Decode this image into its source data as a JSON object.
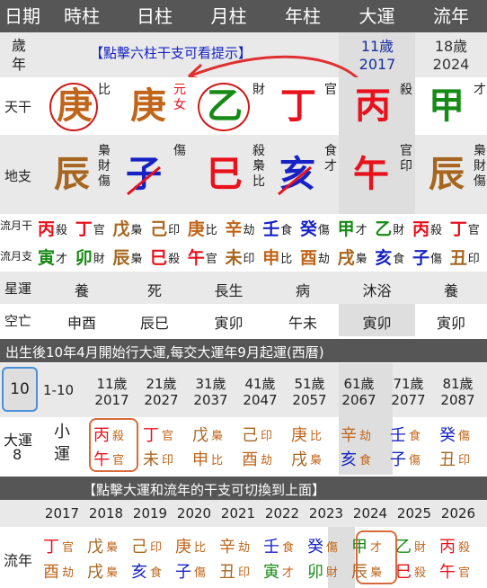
{
  "header": [
    "日期",
    "時柱",
    "日柱",
    "月柱",
    "年柱",
    "大運",
    "流年"
  ],
  "age_label": "歲年",
  "hint_top": "【點擊六柱干支可看提示】",
  "dayun_age": "11歲",
  "dayun_year": "2017",
  "liunian_age": "18歲",
  "liunian_year": "2024",
  "tiangan_label": "天干",
  "tiangan": [
    {
      "c": "庚",
      "g": "比"
    },
    {
      "c": "庚",
      "g": "元女"
    },
    {
      "c": "乙",
      "g": "財"
    },
    {
      "c": "丁",
      "g": "官"
    },
    {
      "c": "丙",
      "g": "殺"
    },
    {
      "c": "甲",
      "g": "才"
    }
  ],
  "dizhi_label": "地支",
  "dizhi": [
    {
      "c": "辰",
      "h": "梟財傷"
    },
    {
      "c": "子",
      "h": "傷"
    },
    {
      "c": "巳",
      "h": "殺梟比"
    },
    {
      "c": "亥",
      "h": "食才"
    },
    {
      "c": "午",
      "h": "官印"
    },
    {
      "c": "辰",
      "h": "梟財傷"
    }
  ],
  "liuyue_gan_label": "流月干",
  "liuyue_gan": [
    [
      "丙",
      "殺"
    ],
    [
      "丁",
      "官"
    ],
    [
      "戊",
      "梟"
    ],
    [
      "己",
      "印"
    ],
    [
      "庚",
      "比"
    ],
    [
      "辛",
      "劫"
    ],
    [
      "壬",
      "食"
    ],
    [
      "癸",
      "傷"
    ],
    [
      "甲",
      "才"
    ],
    [
      "乙",
      "財"
    ],
    [
      "丙",
      "殺"
    ],
    [
      "丁",
      "官"
    ]
  ],
  "liuyue_zhi_label": "流月支",
  "liuyue_zhi": [
    [
      "寅",
      "才"
    ],
    [
      "卯",
      "財"
    ],
    [
      "辰",
      "梟"
    ],
    [
      "巳",
      "殺"
    ],
    [
      "午",
      "官"
    ],
    [
      "未",
      "印"
    ],
    [
      "申",
      "比"
    ],
    [
      "酉",
      "劫"
    ],
    [
      "戌",
      "梟"
    ],
    [
      "亥",
      "食"
    ],
    [
      "子",
      "傷"
    ],
    [
      "丑",
      "印"
    ]
  ],
  "xingyun_label": "星運",
  "xingyun": [
    "養",
    "死",
    "長生",
    "病",
    "沐浴",
    "養"
  ],
  "kongwang_label": "空亡",
  "kongwang": [
    "申酉",
    "辰巳",
    "寅卯",
    "午未",
    "寅卯",
    "寅卯"
  ],
  "qiyun_text": "出生後10年4月開始行大運,每交大運年9月起運(西曆)",
  "dayun_start": "10",
  "dayun_first": "1-10",
  "dayun_ages": [
    "11歲",
    "21歲",
    "31歲",
    "41歲",
    "51歲",
    "61歲",
    "71歲",
    "81歲"
  ],
  "dayun_years": [
    "2017",
    "2027",
    "2037",
    "2047",
    "2057",
    "2067",
    "2077",
    "2087"
  ],
  "dayun_label": "大運",
  "dayun_num": "8",
  "dayun_small": "小運",
  "dayun_pillars": [
    [
      "丙",
      "殺",
      "午",
      "官"
    ],
    [
      "丁",
      "官",
      "未",
      "印"
    ],
    [
      "戊",
      "梟",
      "申",
      "比"
    ],
    [
      "己",
      "印",
      "酉",
      "劫"
    ],
    [
      "庚",
      "比",
      "戌",
      "梟"
    ],
    [
      "辛",
      "劫",
      "亥",
      "食"
    ],
    [
      "壬",
      "食",
      "子",
      "傷"
    ],
    [
      "癸",
      "傷",
      "丑",
      "印"
    ]
  ],
  "hint_bottom": "【點擊大運和流年的干支可切換到上面】",
  "liunian_years": [
    "2017",
    "2018",
    "2019",
    "2020",
    "2021",
    "2022",
    "2023",
    "2024",
    "2025",
    "2026"
  ],
  "liunian_label": "流年",
  "liunian_pillars": [
    [
      "丁",
      "官",
      "酉",
      "劫"
    ],
    [
      "戊",
      "梟",
      "戌",
      "梟"
    ],
    [
      "己",
      "印",
      "亥",
      "食"
    ],
    [
      "庚",
      "比",
      "子",
      "傷"
    ],
    [
      "辛",
      "劫",
      "丑",
      "印"
    ],
    [
      "壬",
      "食",
      "寅",
      "才"
    ],
    [
      "癸",
      "傷",
      "卯",
      "財"
    ],
    [
      "甲",
      "才",
      "辰",
      "梟"
    ],
    [
      "乙",
      "財",
      "巳",
      "殺"
    ],
    [
      "丙",
      "殺",
      "午",
      "官"
    ]
  ],
  "colors": {
    "fire": "#e8111c",
    "earth": "#a7661f",
    "wood": "#178a16",
    "water": "#1622c4",
    "metal": "#c0651a"
  }
}
